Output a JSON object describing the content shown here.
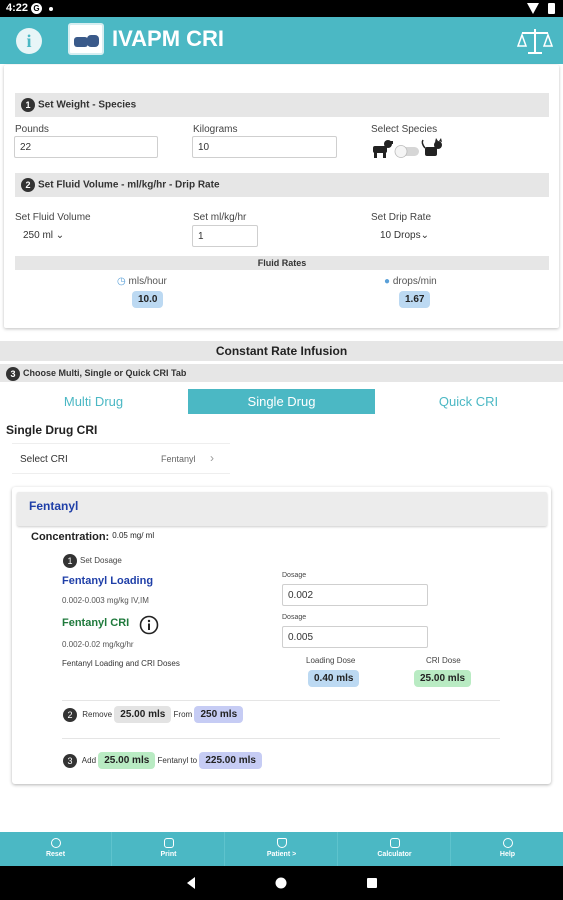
{
  "status": {
    "time": "4:22",
    "g": "G"
  },
  "app": {
    "title": "IVAPM CRI",
    "info_glyph": "i"
  },
  "step1": {
    "num": "1",
    "label": "Set Weight - Species"
  },
  "weight": {
    "pounds_label": "Pounds",
    "pounds_value": "22",
    "kg_label": "Kilograms",
    "kg_value": "10",
    "species_label": "Select Species"
  },
  "step2": {
    "num": "2",
    "label": "Set Fluid Volume - ml/kg/hr - Drip Rate"
  },
  "fluid": {
    "volume_label": "Set Fluid Volume",
    "volume_value": "250 ml",
    "mlkg_label": "Set ml/kg/hr",
    "mlkg_value": "1",
    "drip_label": "Set Drip Rate",
    "drip_value": "10 Drops"
  },
  "fluid_rates": {
    "header": "Fluid Rates",
    "mls_label": "mls/hour",
    "mls_value": "10.0",
    "drops_label": "drops/min",
    "drops_value": "1.67"
  },
  "cri_header": "Constant Rate Infusion",
  "step3": {
    "num": "3",
    "label": "Choose Multi, Single or Quick CRI Tab"
  },
  "tabs": [
    {
      "label": "Multi Drug",
      "active": false
    },
    {
      "label": "Single Drug",
      "active": true
    },
    {
      "label": "Quick CRI",
      "active": false
    }
  ],
  "single": {
    "title": "Single Drug CRI",
    "select_label": "Select CRI",
    "select_value": "Fentanyl"
  },
  "drug": {
    "name": "Fentanyl",
    "concentration_label": "Concentration:",
    "concentration_value": "0.05 mg/ ml",
    "set_dosage_num": "1",
    "set_dosage_label": "Set Dosage",
    "loading_title": "Fentanyl Loading",
    "loading_range": "0.002-0.003 mg/kg IV,IM",
    "dosage_label": "Dosage",
    "loading_dosage": "0.002",
    "cri_title": "Fentanyl CRI",
    "cri_range": "0.002-0.02 mg/kg/hr",
    "cri_dosage": "0.005",
    "doses_label": "Fentanyl Loading and CRI Doses",
    "loading_dose_label": "Loading Dose",
    "loading_dose_value": "0.40 mls",
    "cri_dose_label": "CRI Dose",
    "cri_dose_value": "25.00 mls",
    "remove_num": "2",
    "remove_label": "Remove",
    "remove_value": "25.00 mls",
    "from_label": "From",
    "from_value": "250 mls",
    "add_num": "3",
    "add_label": "Add",
    "add_value": "25.00 mls",
    "to_label": "Fentanyl to",
    "to_value": "225.00 mls"
  },
  "bottom_nav": [
    {
      "label": "Reset",
      "icon": "refresh-icon"
    },
    {
      "label": "Print",
      "icon": "print-icon"
    },
    {
      "label": "Patient >",
      "icon": "patient-icon"
    },
    {
      "label": "Calculator",
      "icon": "calculator-icon"
    },
    {
      "label": "Help",
      "icon": "help-icon"
    }
  ],
  "colors": {
    "teal": "#4bb8c4",
    "drug_blue": "#1f3fa8",
    "drug_green": "#1f7a3c"
  }
}
